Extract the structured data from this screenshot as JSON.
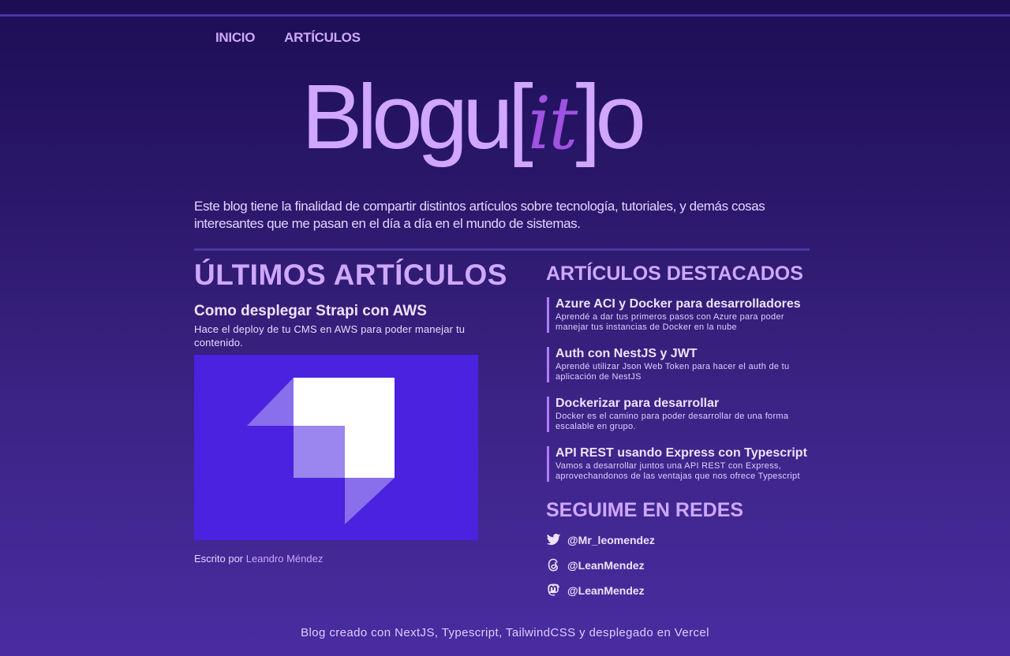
{
  "nav": {
    "items": [
      {
        "label": "INICIO"
      },
      {
        "label": "ARTÍCULOS"
      }
    ]
  },
  "logo": {
    "before": "Blogu[",
    "it": "it",
    "after": "]o"
  },
  "intro": "Este blog tiene la finalidad de compartir distintos artículos sobre tecnología, tutoriales, y demás cosas interesantes que me pasan en el día a día en el mundo de sistemas.",
  "latest": {
    "title": "ÚLTIMOS ARTÍCULOS",
    "article": {
      "title": "Como desplegar Strapi con AWS",
      "description": "Hace el deploy de tu CMS en AWS para poder manejar tu contenido.",
      "byline_prefix": "Escrito por",
      "author": "Leandro Méndez"
    }
  },
  "featured": {
    "title": "ARTÍCULOS DESTACADOS",
    "items": [
      {
        "title": "Azure ACI y Docker para desarrolladores",
        "description": "Aprendé a dar tus primeros pasos con Azure para poder manejar tus instancias de Docker en la nube"
      },
      {
        "title": "Auth con NestJS y JWT",
        "description": "Aprendé utilizar Json Web Token para hacer el auth de tu aplicación de NestJS"
      },
      {
        "title": "Dockerizar para desarrollar",
        "description": "Docker es el camino para poder desarrollar de una forma escalable en grupo."
      },
      {
        "title": "API REST usando Express con Typescript",
        "description": "Vamos a desarrollar juntos una API REST con Express, aprovechandonos de las ventajas que nos ofrece Typescript"
      }
    ]
  },
  "social": {
    "title": "SEGUIME EN REDES",
    "items": [
      {
        "icon": "twitter-icon",
        "handle": "@Mr_leomendez"
      },
      {
        "icon": "threads-icon",
        "handle": "@LeanMendez"
      },
      {
        "icon": "mastodon-icon",
        "handle": "@LeanMendez"
      }
    ]
  },
  "footer": "Blog creado con NextJS, Typescript, TailwindCSS y desplegado en Vercel",
  "colors": {
    "accent": "#cfa8ff",
    "logo_it": "#a052e0",
    "strapi_bg": "#4a22e0"
  }
}
